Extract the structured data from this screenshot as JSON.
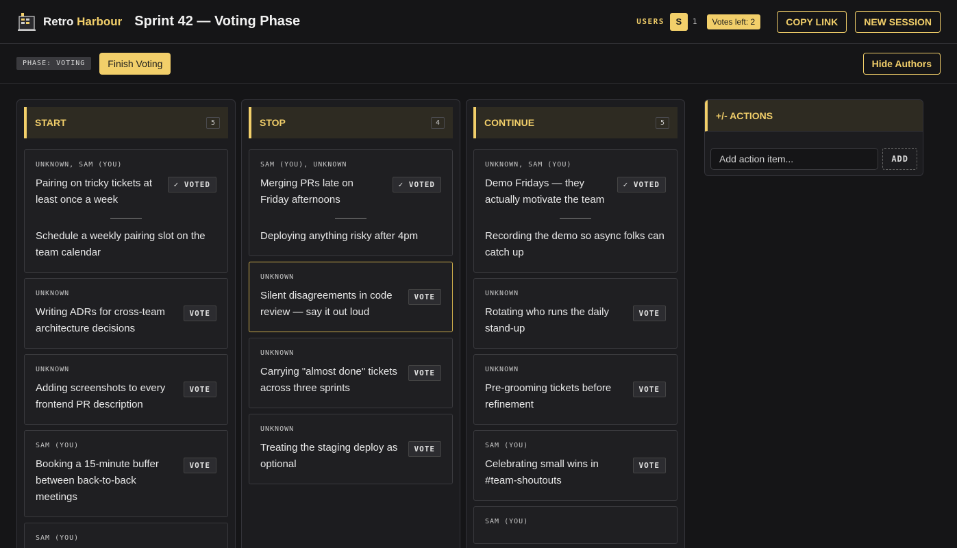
{
  "header": {
    "brand_prefix": "Retro",
    "brand_accent": "Harbour",
    "title": "Sprint 42 — Voting Phase",
    "users_label": "USERS",
    "user_avatar": "S",
    "user_count": "1",
    "votes_left": "Votes left: 2",
    "copy_link": "COPY LINK",
    "new_session": "NEW SESSION"
  },
  "subbar": {
    "phase": "PHASE: VOTING",
    "finish_voting": "Finish Voting",
    "hide_authors": "Hide Authors"
  },
  "columns": [
    {
      "title": "START",
      "count": "5",
      "cards": [
        {
          "author": "UNKNOWN, SAM (YOU)",
          "text": "Pairing on tricky tickets at least once a week",
          "vote": "✓ VOTED",
          "extra": "Schedule a weekly pairing slot on the team calendar"
        },
        {
          "author": "UNKNOWN",
          "text": "Writing ADRs for cross-team architecture decisions",
          "vote": "VOTE"
        },
        {
          "author": "UNKNOWN",
          "text": "Adding screenshots to every frontend PR description",
          "vote": "VOTE"
        },
        {
          "author": "SAM (YOU)",
          "text": "Booking a 15-minute buffer between back-to-back meetings",
          "vote": "VOTE"
        },
        {
          "author": "SAM (YOU)",
          "text": "",
          "vote": ""
        }
      ]
    },
    {
      "title": "STOP",
      "count": "4",
      "cards": [
        {
          "author": "SAM (YOU), UNKNOWN",
          "text": "Merging PRs late on Friday afternoons",
          "vote": "✓ VOTED",
          "extra": "Deploying anything risky after 4pm"
        },
        {
          "author": "UNKNOWN",
          "text": "Silent disagreements in code review — say it out loud",
          "vote": "VOTE"
        },
        {
          "author": "UNKNOWN",
          "text": "Carrying \"almost done\" tickets across three sprints",
          "vote": "VOTE"
        },
        {
          "author": "UNKNOWN",
          "text": "Treating the staging deploy as optional",
          "vote": "VOTE"
        }
      ]
    },
    {
      "title": "CONTINUE",
      "count": "5",
      "cards": [
        {
          "author": "UNKNOWN, SAM (YOU)",
          "text": "Demo Fridays — they actually motivate the team",
          "vote": "✓ VOTED",
          "extra": "Recording the demo so async folks can catch up"
        },
        {
          "author": "UNKNOWN",
          "text": "Rotating who runs the daily stand-up",
          "vote": "VOTE"
        },
        {
          "author": "UNKNOWN",
          "text": "Pre-grooming tickets before refinement",
          "vote": "VOTE"
        },
        {
          "author": "SAM (YOU)",
          "text": "Celebrating small wins in #team-shoutouts",
          "vote": "VOTE"
        },
        {
          "author": "SAM (YOU)",
          "text": "",
          "vote": ""
        }
      ]
    }
  ],
  "actions": {
    "title": "+/-  ACTIONS",
    "placeholder": "Add action item...",
    "add": "ADD"
  }
}
